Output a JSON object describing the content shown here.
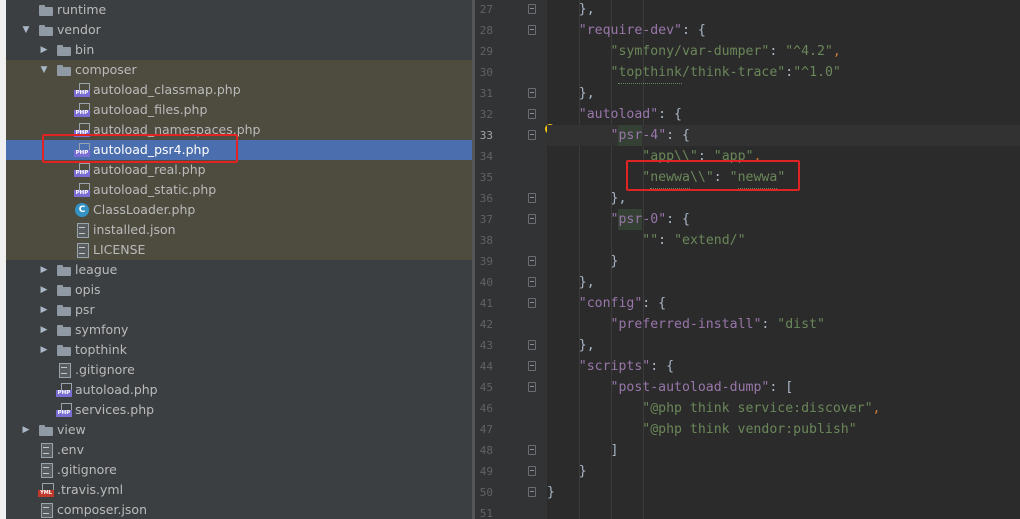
{
  "project_tree": {
    "items": [
      {
        "label": "runtime",
        "kind": "folder",
        "depth": 1,
        "arrow": "",
        "state": ""
      },
      {
        "label": "vendor",
        "kind": "folder",
        "depth": 1,
        "arrow": "expanded",
        "state": ""
      },
      {
        "label": "bin",
        "kind": "folder",
        "depth": 2,
        "arrow": "collapsed",
        "state": ""
      },
      {
        "label": "composer",
        "kind": "folder",
        "depth": 2,
        "arrow": "expanded",
        "state": "modified"
      },
      {
        "label": "autoload_classmap.php",
        "kind": "php",
        "depth": 3,
        "arrow": "",
        "state": "modified"
      },
      {
        "label": "autoload_files.php",
        "kind": "php",
        "depth": 3,
        "arrow": "",
        "state": "modified"
      },
      {
        "label": "autoload_namespaces.php",
        "kind": "php",
        "depth": 3,
        "arrow": "",
        "state": "modified"
      },
      {
        "label": "autoload_psr4.php",
        "kind": "php",
        "depth": 3,
        "arrow": "",
        "state": "selected"
      },
      {
        "label": "autoload_real.php",
        "kind": "php",
        "depth": 3,
        "arrow": "",
        "state": "modified"
      },
      {
        "label": "autoload_static.php",
        "kind": "php",
        "depth": 3,
        "arrow": "",
        "state": "modified"
      },
      {
        "label": "ClassLoader.php",
        "kind": "class",
        "depth": 3,
        "arrow": "",
        "state": "modified"
      },
      {
        "label": "installed.json",
        "kind": "file",
        "depth": 3,
        "arrow": "",
        "state": "modified"
      },
      {
        "label": "LICENSE",
        "kind": "file",
        "depth": 3,
        "arrow": "",
        "state": "modified"
      },
      {
        "label": "league",
        "kind": "folder",
        "depth": 2,
        "arrow": "collapsed",
        "state": ""
      },
      {
        "label": "opis",
        "kind": "folder",
        "depth": 2,
        "arrow": "collapsed",
        "state": ""
      },
      {
        "label": "psr",
        "kind": "folder",
        "depth": 2,
        "arrow": "collapsed",
        "state": ""
      },
      {
        "label": "symfony",
        "kind": "folder",
        "depth": 2,
        "arrow": "collapsed",
        "state": ""
      },
      {
        "label": "topthink",
        "kind": "folder",
        "depth": 2,
        "arrow": "collapsed",
        "state": ""
      },
      {
        "label": ".gitignore",
        "kind": "file",
        "depth": 2,
        "arrow": "",
        "state": ""
      },
      {
        "label": "autoload.php",
        "kind": "php",
        "depth": 2,
        "arrow": "",
        "state": ""
      },
      {
        "label": "services.php",
        "kind": "php",
        "depth": 2,
        "arrow": "",
        "state": ""
      },
      {
        "label": "view",
        "kind": "folder",
        "depth": 1,
        "arrow": "collapsed",
        "state": ""
      },
      {
        "label": ".env",
        "kind": "file",
        "depth": 1,
        "arrow": "",
        "state": ""
      },
      {
        "label": ".gitignore",
        "kind": "file",
        "depth": 1,
        "arrow": "",
        "state": ""
      },
      {
        "label": ".travis.yml",
        "kind": "yml",
        "depth": 1,
        "arrow": "",
        "state": ""
      },
      {
        "label": "composer.json",
        "kind": "file",
        "depth": 1,
        "arrow": "",
        "state": ""
      }
    ]
  },
  "editor": {
    "current_line": 33,
    "lines": [
      {
        "num": "27",
        "fold": true,
        "tokens": [
          {
            "t": "    ",
            "c": "w"
          },
          {
            "t": "},",
            "c": "w"
          }
        ]
      },
      {
        "num": "28",
        "fold": true,
        "tokens": [
          {
            "t": "    ",
            "c": "w"
          },
          {
            "t": "\"require-dev\"",
            "c": "k"
          },
          {
            "t": ": {",
            "c": "w"
          }
        ]
      },
      {
        "num": "29",
        "fold": false,
        "tokens": [
          {
            "t": "        ",
            "c": "w"
          },
          {
            "t": "\"symfony/var-dumper\"",
            "c": "s"
          },
          {
            "t": ": ",
            "c": "w"
          },
          {
            "t": "\"^4.2\"",
            "c": "s"
          },
          {
            "t": ",",
            "c": "p"
          }
        ]
      },
      {
        "num": "30",
        "fold": false,
        "tokens": [
          {
            "t": "        ",
            "c": "w"
          },
          {
            "t": "\"",
            "c": "s"
          },
          {
            "t": "topthink",
            "c": "s typo"
          },
          {
            "t": "/think-trace\"",
            "c": "s"
          },
          {
            "t": ":",
            "c": "w"
          },
          {
            "t": "\"^1.0\"",
            "c": "s"
          }
        ]
      },
      {
        "num": "31",
        "fold": true,
        "tokens": [
          {
            "t": "    ",
            "c": "w"
          },
          {
            "t": "},",
            "c": "w"
          }
        ]
      },
      {
        "num": "32",
        "fold": true,
        "tokens": [
          {
            "t": "    ",
            "c": "w"
          },
          {
            "t": "\"autoload\"",
            "c": "k"
          },
          {
            "t": ": {",
            "c": "w"
          }
        ]
      },
      {
        "num": "33",
        "fold": true,
        "tokens": [
          {
            "t": "        ",
            "c": "w"
          },
          {
            "t": "\"",
            "c": "k"
          },
          {
            "t": "psr",
            "c": "k hl"
          },
          {
            "t": "-4\"",
            "c": "k"
          },
          {
            "t": ": {",
            "c": "w"
          }
        ]
      },
      {
        "num": "34",
        "fold": false,
        "tokens": [
          {
            "t": "            ",
            "c": "w"
          },
          {
            "t": "\"app\\\\\"",
            "c": "s"
          },
          {
            "t": ": ",
            "c": "w"
          },
          {
            "t": "\"app\"",
            "c": "s"
          },
          {
            "t": ",",
            "c": "p"
          }
        ]
      },
      {
        "num": "35",
        "fold": false,
        "tokens": [
          {
            "t": "            ",
            "c": "w"
          },
          {
            "t": "\"",
            "c": "s"
          },
          {
            "t": "newwa",
            "c": "s typo"
          },
          {
            "t": "\\\\\"",
            "c": "s"
          },
          {
            "t": ": ",
            "c": "w"
          },
          {
            "t": "\"",
            "c": "s"
          },
          {
            "t": "newwa",
            "c": "s typo"
          },
          {
            "t": "\"",
            "c": "s"
          }
        ]
      },
      {
        "num": "36",
        "fold": true,
        "tokens": [
          {
            "t": "        ",
            "c": "w"
          },
          {
            "t": "},",
            "c": "w"
          }
        ]
      },
      {
        "num": "37",
        "fold": true,
        "tokens": [
          {
            "t": "        ",
            "c": "w"
          },
          {
            "t": "\"",
            "c": "k"
          },
          {
            "t": "psr",
            "c": "k hl"
          },
          {
            "t": "-0\"",
            "c": "k"
          },
          {
            "t": ": {",
            "c": "w"
          }
        ]
      },
      {
        "num": "38",
        "fold": false,
        "tokens": [
          {
            "t": "            ",
            "c": "w"
          },
          {
            "t": "\"\"",
            "c": "s"
          },
          {
            "t": ": ",
            "c": "w"
          },
          {
            "t": "\"extend/\"",
            "c": "s"
          }
        ]
      },
      {
        "num": "39",
        "fold": true,
        "tokens": [
          {
            "t": "        ",
            "c": "w"
          },
          {
            "t": "}",
            "c": "w"
          }
        ]
      },
      {
        "num": "40",
        "fold": true,
        "tokens": [
          {
            "t": "    ",
            "c": "w"
          },
          {
            "t": "},",
            "c": "w"
          }
        ]
      },
      {
        "num": "41",
        "fold": true,
        "tokens": [
          {
            "t": "    ",
            "c": "w"
          },
          {
            "t": "\"config\"",
            "c": "k"
          },
          {
            "t": ": {",
            "c": "w"
          }
        ]
      },
      {
        "num": "42",
        "fold": false,
        "tokens": [
          {
            "t": "        ",
            "c": "w"
          },
          {
            "t": "\"preferred-install\"",
            "c": "k"
          },
          {
            "t": ": ",
            "c": "w"
          },
          {
            "t": "\"dist\"",
            "c": "s"
          }
        ]
      },
      {
        "num": "43",
        "fold": true,
        "tokens": [
          {
            "t": "    ",
            "c": "w"
          },
          {
            "t": "},",
            "c": "w"
          }
        ]
      },
      {
        "num": "44",
        "fold": true,
        "tokens": [
          {
            "t": "    ",
            "c": "w"
          },
          {
            "t": "\"scripts\"",
            "c": "k"
          },
          {
            "t": ": {",
            "c": "w"
          }
        ]
      },
      {
        "num": "45",
        "fold": true,
        "tokens": [
          {
            "t": "        ",
            "c": "w"
          },
          {
            "t": "\"post-autoload-dump\"",
            "c": "k"
          },
          {
            "t": ": [",
            "c": "w"
          }
        ]
      },
      {
        "num": "46",
        "fold": false,
        "tokens": [
          {
            "t": "            ",
            "c": "w"
          },
          {
            "t": "\"@php think service:discover\"",
            "c": "s"
          },
          {
            "t": ",",
            "c": "p"
          }
        ]
      },
      {
        "num": "47",
        "fold": false,
        "tokens": [
          {
            "t": "            ",
            "c": "w"
          },
          {
            "t": "\"@php think vendor:publish\"",
            "c": "s"
          }
        ]
      },
      {
        "num": "48",
        "fold": true,
        "tokens": [
          {
            "t": "        ",
            "c": "w"
          },
          {
            "t": "]",
            "c": "w"
          }
        ]
      },
      {
        "num": "49",
        "fold": true,
        "tokens": [
          {
            "t": "    ",
            "c": "w"
          },
          {
            "t": "}",
            "c": "w"
          }
        ]
      },
      {
        "num": "50",
        "fold": true,
        "tokens": [
          {
            "t": "}",
            "c": "w"
          }
        ]
      },
      {
        "num": "51",
        "fold": false,
        "tokens": []
      }
    ]
  },
  "colors": {
    "tree_bg": "#3c3f41",
    "modified_bg": "#4e4b3f",
    "selected_bg": "#4b6eaf",
    "editor_bg": "#2b2b2b",
    "string": "#6a8759",
    "key": "#9876aa",
    "annotation": "#e02424"
  }
}
